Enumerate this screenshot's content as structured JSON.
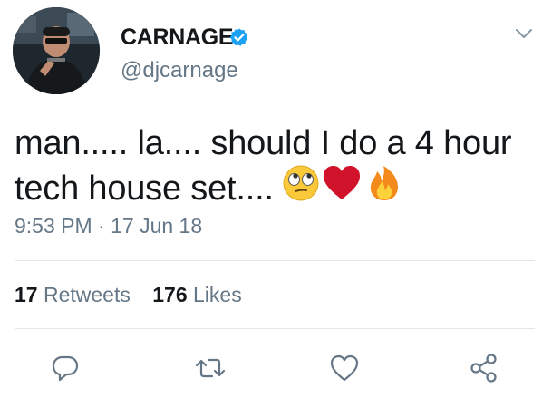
{
  "user": {
    "display_name": "CARNAGE",
    "handle": "@djcarnage",
    "verified": true
  },
  "tweet": {
    "text_lines": [
      "man..... la.... should I do a 4 hour",
      "tech house set...."
    ],
    "emojis": [
      "face-with-rolling-eyes",
      "red-heart",
      "fire"
    ],
    "timestamp": "9:53 PM · 17 Jun 18"
  },
  "stats": {
    "retweets_count": "17",
    "retweets_label": "Retweets",
    "likes_count": "176",
    "likes_label": "Likes"
  },
  "actions": [
    "reply-icon",
    "retweet-icon",
    "like-icon",
    "share-icon"
  ],
  "colors": {
    "text_primary": "#14171a",
    "text_secondary": "#657786",
    "verified_blue": "#1da1f2",
    "divider": "#e1e8ed",
    "heart_red": "#d0122b"
  }
}
